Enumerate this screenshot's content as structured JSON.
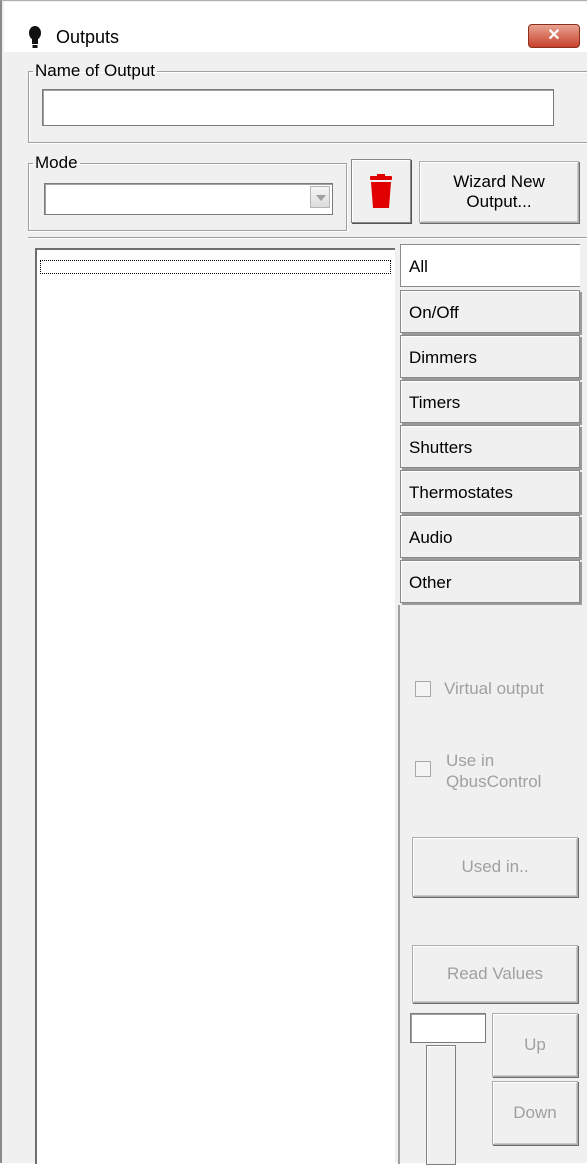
{
  "window": {
    "title": "Outputs",
    "close_glyph": "✕"
  },
  "name_group": {
    "legend": "Name of Output",
    "value": ""
  },
  "mode_group": {
    "legend": "Mode",
    "value": ""
  },
  "buttons": {
    "wizard_line1": "Wizard New",
    "wizard_line2": "Output...",
    "used_in": "Used in..",
    "read_values": "Read Values",
    "up": "Up",
    "down": "Down"
  },
  "tabs": [
    "All",
    "On/Off",
    "Dimmers",
    "Timers",
    "Shutters",
    "Thermostates",
    "Audio",
    "Other"
  ],
  "options": {
    "virtual_output": "Virtual output",
    "use_in_line1": "Use in",
    "use_in_line2": "QbusControl"
  },
  "icons": {
    "window_icon": "lightbulb-icon",
    "delete_icon": "trash-icon"
  },
  "colors": {
    "delete_red": "#e00000",
    "close_red": "#c7422c"
  }
}
